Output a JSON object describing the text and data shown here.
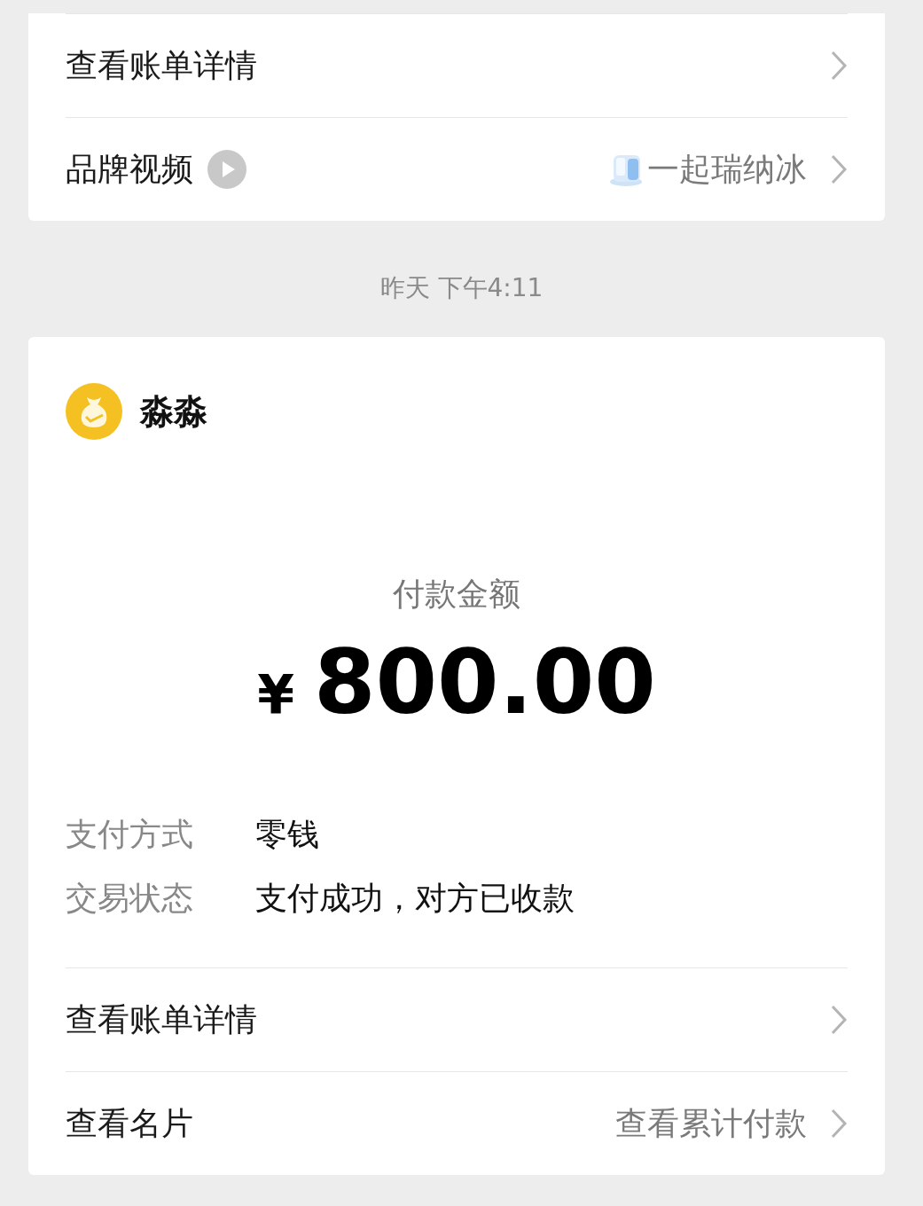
{
  "top_card": {
    "rows": [
      {
        "kind": "link",
        "label": "查看账单详情"
      },
      {
        "kind": "video",
        "label": "品牌视频",
        "value": "一起瑞纳冰"
      }
    ]
  },
  "timestamp": "昨天 下午4:11",
  "payment_card": {
    "merchant": "淼淼",
    "amount_label": "付款金额",
    "currency": "¥",
    "amount": "800.00",
    "details": [
      {
        "label": "支付方式",
        "value": "零钱"
      },
      {
        "label": "交易状态",
        "value": "支付成功，对方已收款"
      }
    ],
    "rows": [
      {
        "kind": "link",
        "label": "查看账单详情"
      },
      {
        "kind": "link",
        "label": "查看名片",
        "value": "查看累计付款"
      }
    ]
  }
}
